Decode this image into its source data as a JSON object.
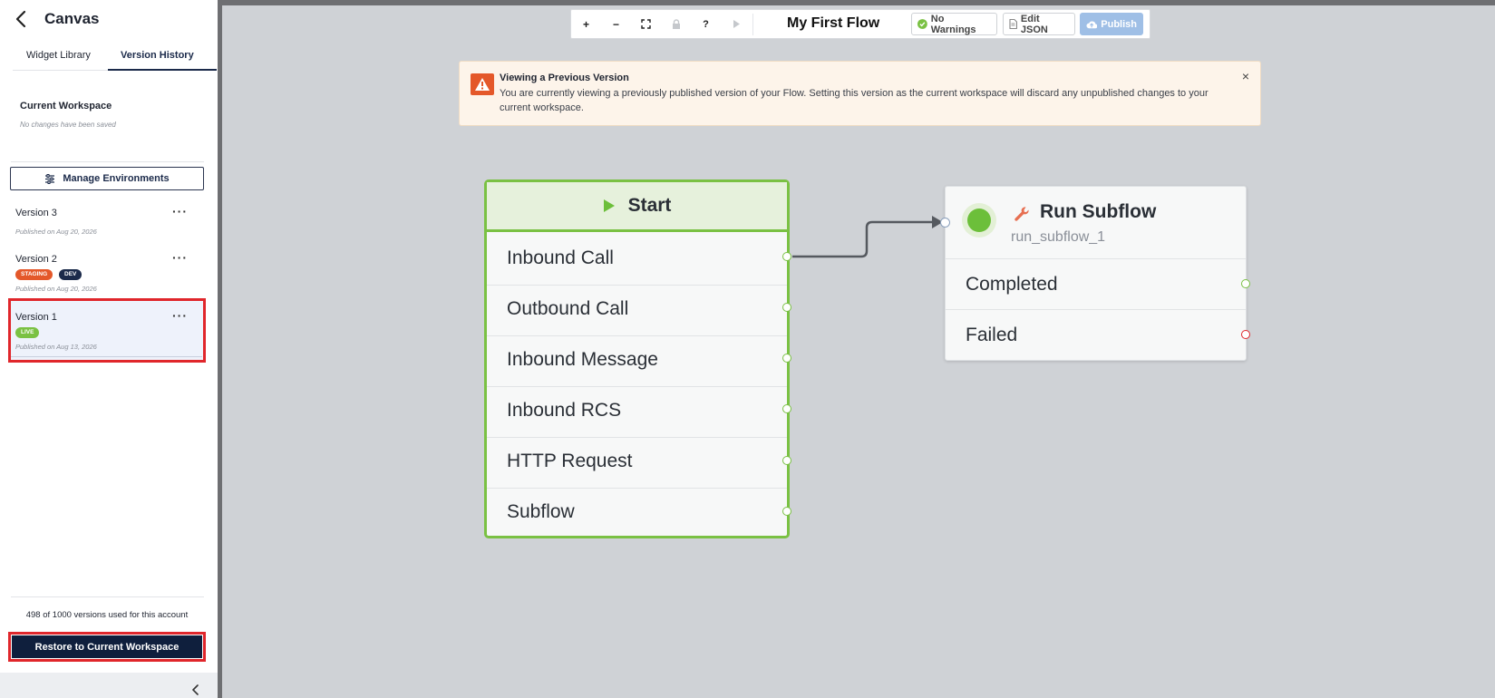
{
  "sidebar": {
    "title": "Canvas",
    "tabs": [
      {
        "label": "Widget Library"
      },
      {
        "label": "Version History"
      }
    ],
    "current_workspace": {
      "title": "Current Workspace",
      "subtitle": "No changes have been saved"
    },
    "manage_environments_label": "Manage Environments",
    "versions": [
      {
        "title": "Version 3",
        "badges": [],
        "date": "Published on Aug 20, 2026",
        "more": "···"
      },
      {
        "title": "Version 2",
        "badges": [
          "STAGING",
          "DEV"
        ],
        "date": "Published on Aug 20, 2026",
        "more": "···"
      },
      {
        "title": "Version 1",
        "badges": [
          "LIVE"
        ],
        "date": "Published on Aug 13, 2026",
        "more": "···"
      }
    ],
    "quota_text": "498 of 1000 versions used for this account",
    "restore_label": "Restore to Current Workspace"
  },
  "toolbar": {
    "zoom_in": "+",
    "zoom_out": "−",
    "fit": "⛶",
    "lock": "🔒",
    "help": "?",
    "play": "▶",
    "flow_title": "My First Flow",
    "warnings_label": "No Warnings",
    "edit_json_label": "Edit JSON",
    "publish_label": "Publish"
  },
  "banner": {
    "title": "Viewing a Previous Version",
    "body": "You are currently viewing a previously published version of your Flow. Setting this version as the current workspace will discard any unpublished changes to your current workspace.",
    "close": "×"
  },
  "start_widget": {
    "title": "Start",
    "triggers": [
      "Inbound Call",
      "Outbound Call",
      "Inbound Message",
      "Inbound RCS",
      "HTTP Request",
      "Subflow"
    ]
  },
  "subflow_widget": {
    "title": "Run Subflow",
    "name": "run_subflow_1",
    "transitions": [
      "Completed",
      "Failed"
    ]
  },
  "colors": {
    "accent_green": "#7ac143",
    "navy": "#0f1f3d",
    "staging": "#e4582a",
    "dev": "#1b2a4a",
    "live": "#7ac143",
    "highlight_red": "#e0262b"
  }
}
